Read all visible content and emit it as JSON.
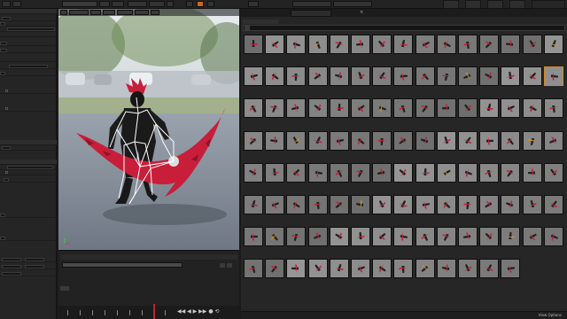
{
  "toolbar": {
    "tabs": [
      {
        "icon": "skeleton-icon"
      },
      {
        "icon": "mesh-icon"
      },
      {
        "icon": "animation-icon"
      },
      {
        "icon": "blueprint-icon"
      },
      {
        "icon": "physics-icon"
      }
    ],
    "mode_icons": [
      "skeleton-mode-icon",
      "mesh-mode-icon",
      "animation-mode-icon",
      "blueprint-mode-icon"
    ]
  },
  "viewport": {
    "buttons": [
      "Perspective",
      "Lit",
      "Show",
      "Character",
      "LOD Auto",
      "x1.0"
    ],
    "info_lines": [
      "",
      "",
      "",
      "",
      "",
      "",
      ""
    ]
  },
  "browser": {
    "tab_label": "",
    "search_placeholder": "",
    "status_count": "",
    "status_view": "View Options",
    "columns": 15,
    "assets": [
      "",
      "",
      "",
      "",
      "",
      "",
      "",
      "",
      "",
      "",
      "",
      "",
      "",
      "",
      "",
      "",
      "",
      "",
      "",
      "",
      "",
      "",
      "",
      "",
      "",
      "",
      "",
      "",
      "",
      "",
      "",
      "",
      "",
      "",
      "",
      "",
      "",
      "",
      "",
      "",
      "",
      "",
      "",
      "",
      "",
      "",
      "",
      "",
      "",
      "",
      "",
      "",
      "",
      "",
      "",
      "",
      "",
      "",
      "",
      "",
      "",
      "",
      "",
      "",
      "",
      "",
      "",
      "",
      "",
      "",
      "",
      "",
      "",
      "",
      "",
      "",
      "",
      "",
      "",
      "",
      "",
      "",
      "",
      "",
      "",
      "",
      "",
      "",
      "",
      "",
      "",
      "",
      "",
      "",
      "",
      "",
      "",
      "",
      "",
      "",
      "",
      "",
      "",
      "",
      "",
      "",
      "",
      "",
      "",
      "",
      "",
      "",
      "",
      "",
      "",
      "",
      "",
      ""
    ],
    "selected_index": 29
  },
  "colors": {
    "accent": "#d08a2a",
    "character": "#c81e3a",
    "bone": "#ffffff",
    "playhead": "#c0262c"
  }
}
